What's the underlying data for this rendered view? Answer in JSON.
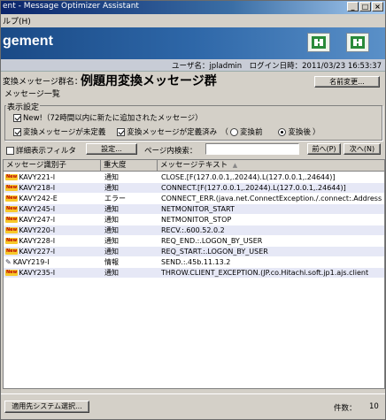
{
  "window": {
    "title": "ent - Message Optimizer Assistant",
    "min": "_",
    "max": "□",
    "close": "×"
  },
  "menu": {
    "label": "ルプ(H)"
  },
  "banner": {
    "title": "gement"
  },
  "userbar": {
    "text": "ユーザ名：jpladmin　ログイン日時：2011/03/23 16:53:37"
  },
  "group": {
    "label": "変換メッセージ群名：",
    "name": "例題用変換メッセージ群",
    "rename_button": "名前変更..."
  },
  "section": {
    "label": "メッセージ一覧"
  },
  "display_settings": {
    "legend": "表示設定",
    "new_label": "New!（72時間以内に新たに追加されたメッセージ）",
    "undefined_label": "変換メッセージが未定義",
    "defined_label": "変換メッセージが定義済み　（",
    "before_label": "変換前",
    "after_label": "変換後",
    "close_paren": "）"
  },
  "filter": {
    "detail_filter": "詳細表示フィルタ",
    "settings_button": "設定...",
    "search_label": "ページ内検索：",
    "prev_button": "前へ(P)",
    "next_button": "次へ(N)"
  },
  "table": {
    "columns": [
      "メッセージ識別子",
      "重大度",
      "メッセージテキスト"
    ],
    "rows": [
      {
        "new": true,
        "icon": "",
        "id": "KAVY221-I",
        "severity": "通知",
        "text": "CLOSE.[F(127.0.0.1,.20244).L(127.0.0.1,.24644)]"
      },
      {
        "new": true,
        "icon": "",
        "id": "KAVY218-I",
        "severity": "通知",
        "text": "CONNECT.[F(127.0.0.1,.20244).L(127.0.0.1,.24644)]"
      },
      {
        "new": true,
        "icon": "",
        "id": "KAVY242-E",
        "severity": "エラー",
        "text": "CONNECT_ERR.(java.net.ConnectException./.connect:.Address"
      },
      {
        "new": true,
        "icon": "",
        "id": "KAVY245-I",
        "severity": "通知",
        "text": "NETMONITOR_START"
      },
      {
        "new": true,
        "icon": "",
        "id": "KAVY247-I",
        "severity": "通知",
        "text": "NETMONITOR_STOP"
      },
      {
        "new": true,
        "icon": "",
        "id": "KAVY220-I",
        "severity": "通知",
        "text": "RECV.:.600.52.0.2"
      },
      {
        "new": true,
        "icon": "",
        "id": "KAVY228-I",
        "severity": "通知",
        "text": "REQ_END.:.LOGON_BY_USER"
      },
      {
        "new": true,
        "icon": "",
        "id": "KAVY227-I",
        "severity": "通知",
        "text": "REQ_START.:.LOGON_BY_USER"
      },
      {
        "new": false,
        "icon": "pen-icon",
        "id": "KAVY219-I",
        "severity": "情報",
        "text": "SEND.:.45b.11.13.2"
      },
      {
        "new": true,
        "icon": "",
        "id": "KAVY235-I",
        "severity": "通知",
        "text": "THROW.CLIENT_EXCEPTION.(JP.co.Hitachi.soft.jp1.ajs.client"
      }
    ]
  },
  "status": {
    "system_button": "適用先システム選択...",
    "count_label": "件数：",
    "count_value": "10"
  },
  "colors": {
    "banner": "#1a4a86",
    "alt_row": "#e6e8f6",
    "new_badge": "#f7c92a"
  }
}
